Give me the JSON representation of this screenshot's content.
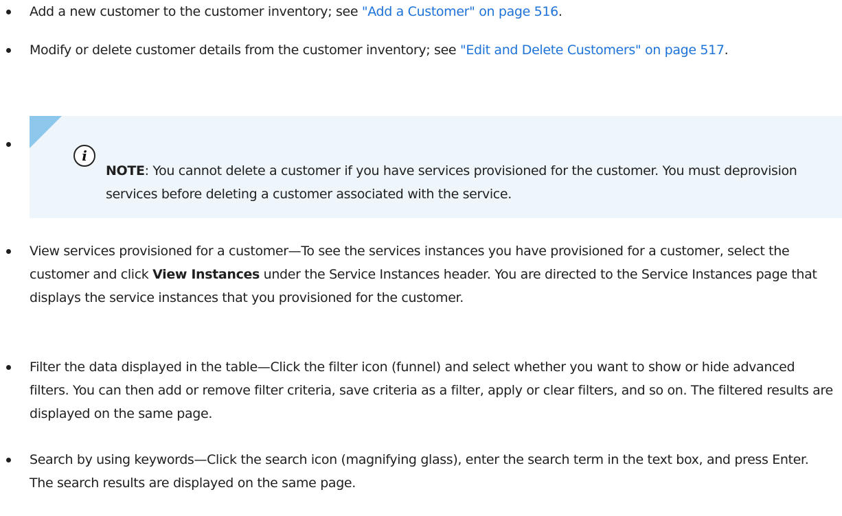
{
  "bullets": {
    "add": {
      "text": "Add a new customer to the customer inventory; see ",
      "link": "\"Add a Customer\" on page 516",
      "after": "."
    },
    "modify": {
      "text": "Modify or delete customer details from the customer inventory; see ",
      "link": "\"Edit and Delete Customers\" on page 517",
      "after": "."
    },
    "view": {
      "lead": "View services provisioned for a customer—To see the services instances you have provisioned for a customer, select the customer and click ",
      "bold": "View Instances",
      "rest": " under the Service Instances header. You are directed to the Service Instances page that displays the service instances that you provisioned for the customer."
    },
    "filter": {
      "text": "Filter the data displayed in the table—Click the filter icon (funnel) and select whether you want to show or hide advanced filters. You can then add or remove filter criteria, save criteria as a filter, apply or clear filters, and so on. The filtered results are displayed on the same page."
    },
    "search": {
      "text": "Search by using keywords—Click the search icon (magnifying glass), enter the search term in the text box, and press Enter. The search results are displayed on the same page."
    }
  },
  "note": {
    "label": "NOTE",
    "text": ": You cannot delete a customer if you have services provisioned for the customer. You must deprovision services before deleting a customer associated with the service.",
    "icon": "info-icon",
    "accent_color": "#8ec7ec",
    "background_color": "#eef6fc"
  },
  "link_color": "#1e73d9"
}
